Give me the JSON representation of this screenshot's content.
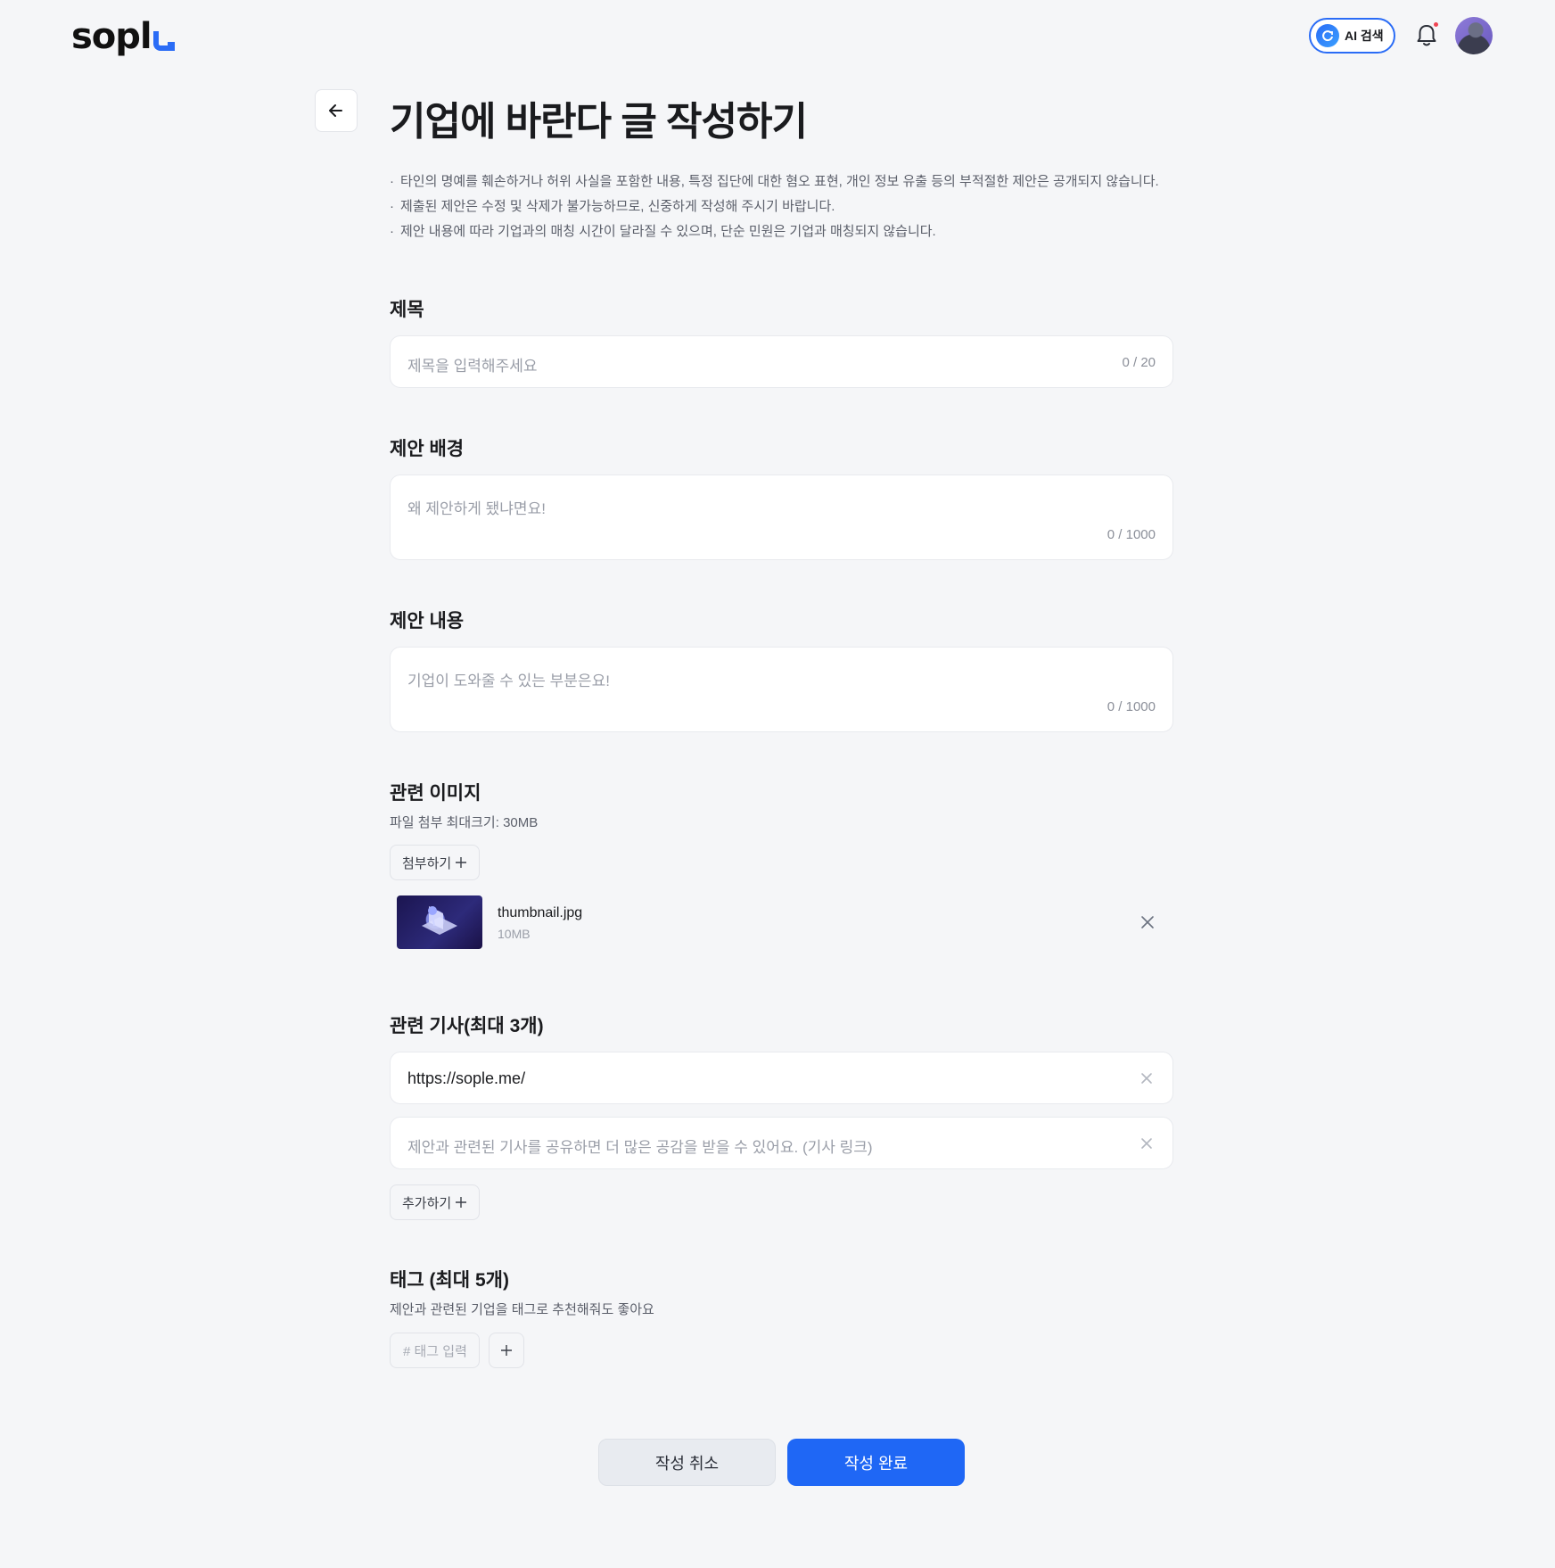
{
  "header": {
    "logo_text": "sopl",
    "ai_search_label": "AI 검색",
    "icons": [
      "ai-search-icon",
      "bell-icon",
      "avatar"
    ]
  },
  "page": {
    "title": "기업에 바란다 글 작성하기",
    "notices": [
      "타인의 명예를 훼손하거나 허위 사실을 포함한 내용, 특정 집단에 대한 혐오 표현, 개인 정보 유출 등의 부적절한 제안은 공개되지 않습니다.",
      "제출된 제안은 수정 및 삭제가 불가능하므로, 신중하게 작성해 주시기 바랍니다.",
      "제안 내용에 따라 기업과의 매칭 시간이 달라질 수 있으며, 단순 민원은 기업과 매칭되지 않습니다."
    ]
  },
  "form": {
    "title": {
      "label": "제목",
      "placeholder": "제목을 입력해주세요",
      "count": "0 / 20"
    },
    "background": {
      "label": "제안 배경",
      "placeholder": "왜 제안하게 됐냐면요!",
      "count": "0 / 1000"
    },
    "content": {
      "label": "제안 내용",
      "placeholder": "기업이 도와줄 수 있는 부분은요!",
      "count": "0 / 1000"
    },
    "images": {
      "label": "관련 이미지",
      "sub": "파일 첨부 최대크기: 30MB",
      "attach_label": "첨부하기",
      "files": [
        {
          "name": "thumbnail.jpg",
          "size": "10MB"
        }
      ]
    },
    "articles": {
      "label": "관련 기사(최대 3개)",
      "links": [
        {
          "value": "https://sople.me/",
          "placeholder": ""
        },
        {
          "value": "",
          "placeholder": "제안과 관련된 기사를 공유하면 더 많은 공감을 받을 수 있어요. (기사 링크)"
        }
      ],
      "add_label": "추가하기"
    },
    "tags": {
      "label": "태그 (최대 5개)",
      "sub": "제안과 관련된 기업을  태그로 추천해줘도 좋아요",
      "placeholder": "# 태그 입력"
    }
  },
  "actions": {
    "cancel_label": "작성 취소",
    "submit_label": "작성 완료"
  },
  "colors": {
    "accent": "#1f67f5",
    "background": "#f5f6f8",
    "notification_dot": "#f04452"
  }
}
